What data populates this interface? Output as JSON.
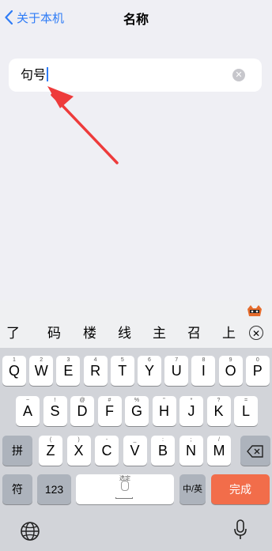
{
  "nav": {
    "back_label": "关于本机",
    "title": "名称"
  },
  "field": {
    "value": "句号"
  },
  "candidates": [
    "了",
    "码",
    "楼",
    "线",
    "主",
    "召",
    "上"
  ],
  "keyboard": {
    "row1": [
      [
        "Q",
        "1"
      ],
      [
        "W",
        "2"
      ],
      [
        "E",
        "3"
      ],
      [
        "R",
        "4"
      ],
      [
        "T",
        "5"
      ],
      [
        "Y",
        "6"
      ],
      [
        "U",
        "7"
      ],
      [
        "I",
        "8"
      ],
      [
        "O",
        "9"
      ],
      [
        "P",
        "0"
      ]
    ],
    "row2": [
      [
        "A",
        "~"
      ],
      [
        "S",
        "!"
      ],
      [
        "D",
        "@"
      ],
      [
        "F",
        "#"
      ],
      [
        "G",
        "%"
      ],
      [
        "H",
        "\""
      ],
      [
        "J",
        "*"
      ],
      [
        "K",
        "?"
      ],
      [
        "L",
        "="
      ]
    ],
    "row3": [
      [
        "Z",
        "("
      ],
      [
        "X",
        ")"
      ],
      [
        "C",
        "-"
      ],
      [
        "V",
        "_"
      ],
      [
        "B",
        ":"
      ],
      [
        "N",
        ";"
      ],
      [
        "M",
        "/"
      ]
    ],
    "pin_label": "拼",
    "fu_label": "符",
    "num_label": "123",
    "space_sub": "选定",
    "zh_label": "中/英",
    "done_label": "完成"
  },
  "colors": {
    "accent": "#2f7cf6",
    "done": "#f26d4a",
    "arrow": "#ee3b3b"
  }
}
